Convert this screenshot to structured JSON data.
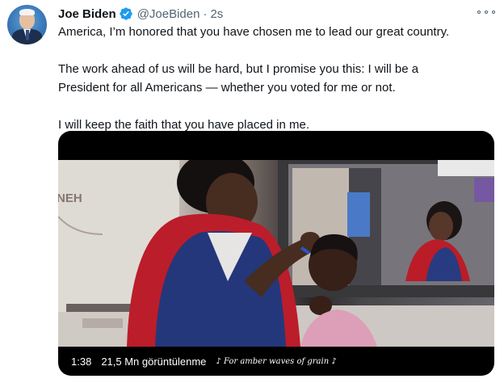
{
  "author": {
    "name": "Joe Biden",
    "handle": "@JoeBiden",
    "separator": "·",
    "time": "2s"
  },
  "tweet": {
    "paragraphs": [
      "America, I’m honored that you have chosen me to lead our great country.",
      "The work ahead of us will be hard, but I promise you this: I will be a\nPresident for all Americans — whether you voted for me or not.",
      "I will keep the faith that you have placed in me."
    ]
  },
  "video": {
    "duration": "1:38",
    "views": "21,5 Mn görüntülenme",
    "caption": "♪ For amber waves of grain ♪",
    "wall_text": "NEH"
  },
  "icons": {
    "verified": "verified-badge-icon",
    "more": "more-options-icon"
  },
  "colors": {
    "verified": "#1d9bf0",
    "secondary_text": "#536471",
    "primary_text": "#0f1419"
  }
}
